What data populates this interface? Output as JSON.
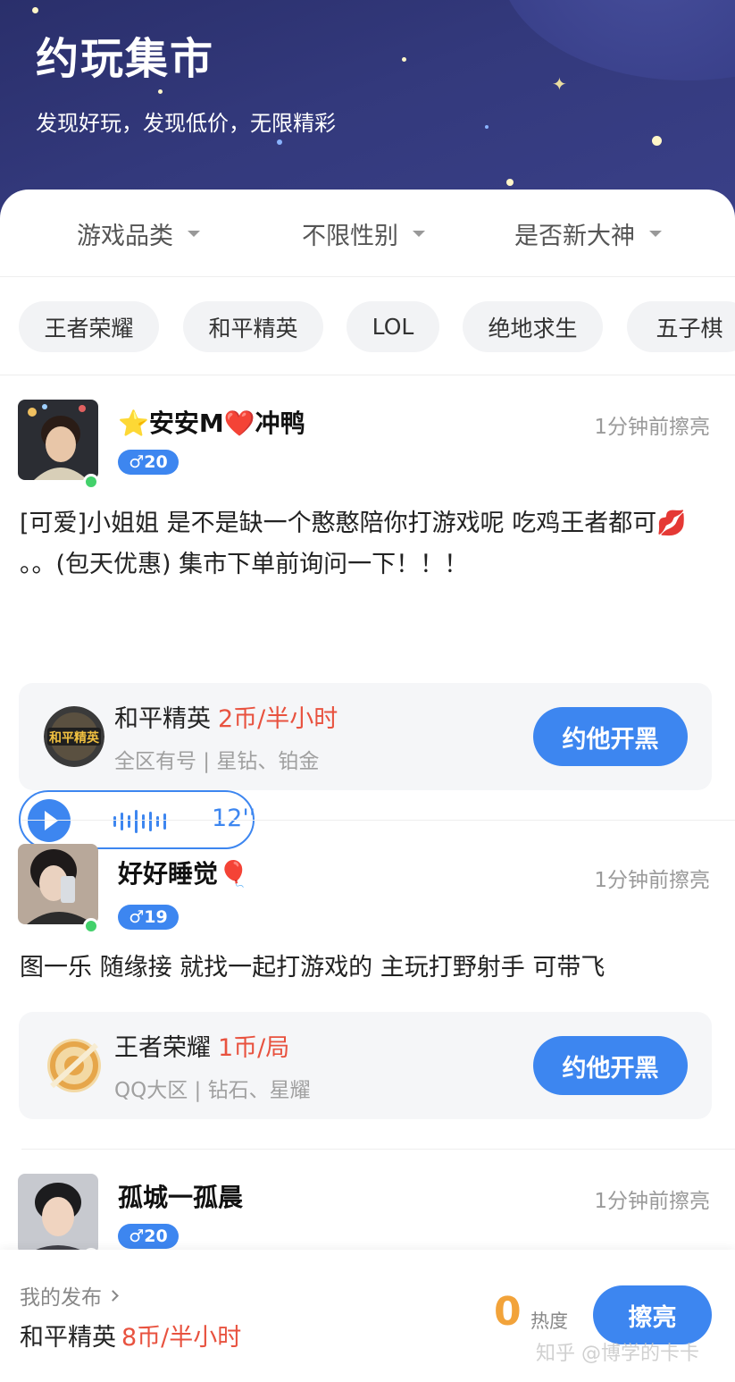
{
  "header": {
    "title": "约玩集市",
    "subtitle": "发现好玩，发现低价，无限精彩"
  },
  "filters": [
    {
      "label": "游戏品类"
    },
    {
      "label": "不限性别"
    },
    {
      "label": "是否新大神"
    }
  ],
  "chips": [
    "王者荣耀",
    "和平精英",
    "LOL",
    "绝地求生",
    "五子棋"
  ],
  "posts": [
    {
      "username": "⭐安安M❤️冲鸭",
      "badge": "♂20",
      "time": "1分钟前擦亮",
      "text": "[可爱]小姐姐 是不是缺一个憨憨陪你打游戏呢 吃鸡王者都可💋 。。(包天优惠) 集市下单前询问一下！！！",
      "voice_duration": "12''",
      "game": "和平精英",
      "price": "2币/半小时",
      "detail": "全区有号 | 星钻、铂金",
      "cta": "约他开黑",
      "logo_text": "和平精英"
    },
    {
      "username": "好好睡觉🎈",
      "badge": "♂19",
      "time": "1分钟前擦亮",
      "text": "图一乐 随缘接 就找一起打游戏的 主玩打野射手 可带飞",
      "game": "王者荣耀",
      "price": "1币/局",
      "detail": "QQ大区 | 钻石、星耀",
      "cta": "约他开黑"
    },
    {
      "username": "孤城一孤晨",
      "badge": "♂20",
      "time": "1分钟前擦亮"
    }
  ],
  "bottom": {
    "my_post_label": "我的发布",
    "my_game": "和平精英",
    "my_price": "8币/半小时",
    "heat_value": "0",
    "heat_label": "热度",
    "polish_label": "擦亮",
    "watermark": "知乎 @博学的卡卡"
  },
  "colors": {
    "accent": "#3d86f0",
    "price": "#e8523f",
    "heat": "#f2a33a",
    "online": "#43d16b"
  }
}
